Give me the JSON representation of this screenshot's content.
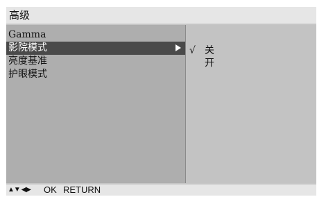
{
  "title": "高级",
  "menu": {
    "items": [
      {
        "label": "Gamma",
        "selected": false
      },
      {
        "label": "影院模式",
        "selected": true
      },
      {
        "label": "亮度基准",
        "selected": false
      },
      {
        "label": "护眼模式",
        "selected": false
      }
    ]
  },
  "options": {
    "items": [
      {
        "label": "关",
        "checked": true
      },
      {
        "label": "开",
        "checked": false
      }
    ],
    "check_mark": "√"
  },
  "hints": {
    "nav_icons": "▲▼ ◀▶",
    "ok": "OK",
    "return": "RETURN"
  }
}
